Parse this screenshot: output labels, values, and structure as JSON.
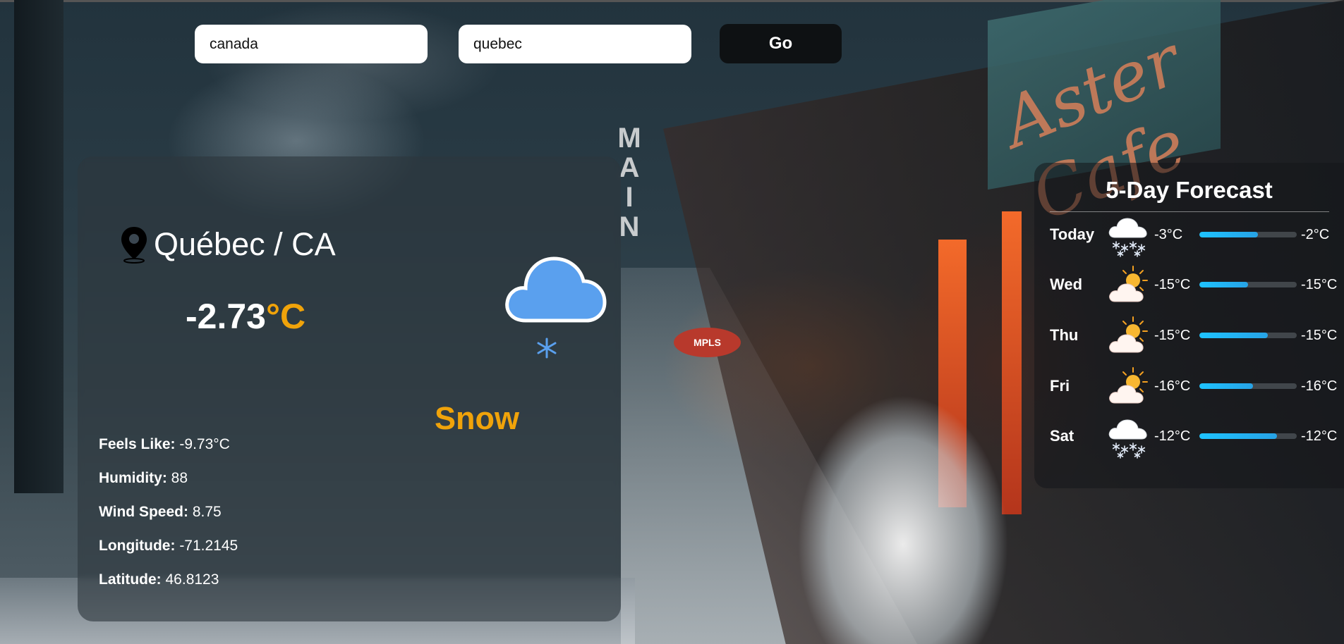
{
  "search": {
    "country_value": "canada",
    "city_value": "quebec",
    "go_label": "Go"
  },
  "current": {
    "location": "Québec / CA",
    "temp_value": "-2.73",
    "temp_unit": "°C",
    "condition": "Snow",
    "icon": "cloud-snow-icon",
    "details": [
      {
        "label": "Feels Like:",
        "value": "-9.73°C"
      },
      {
        "label": "Humidity:",
        "value": "88"
      },
      {
        "label": "Wind Speed:",
        "value": "8.75"
      },
      {
        "label": "Longitude:",
        "value": "-71.2145"
      },
      {
        "label": "Latitude:",
        "value": "46.8123"
      }
    ]
  },
  "forecast": {
    "title": "5-Day Forecast",
    "days": [
      {
        "day": "Today",
        "icon": "snow-icon",
        "low": "-3°C",
        "high": "-2°C",
        "fill": 0.6
      },
      {
        "day": "Wed",
        "icon": "partly-sunny-icon",
        "low": "-15°C",
        "high": "-15°C",
        "fill": 0.5
      },
      {
        "day": "Thu",
        "icon": "partly-sunny-icon",
        "low": "-15°C",
        "high": "-15°C",
        "fill": 0.7
      },
      {
        "day": "Fri",
        "icon": "partly-sunny-icon",
        "low": "-16°C",
        "high": "-16°C",
        "fill": 0.55
      },
      {
        "day": "Sat",
        "icon": "snow-icon",
        "low": "-12°C",
        "high": "-12°C",
        "fill": 0.8
      }
    ]
  },
  "colors": {
    "accent": "#f0a30a",
    "cloud": "#5aa0ee",
    "bar": "#1ec3ff"
  }
}
